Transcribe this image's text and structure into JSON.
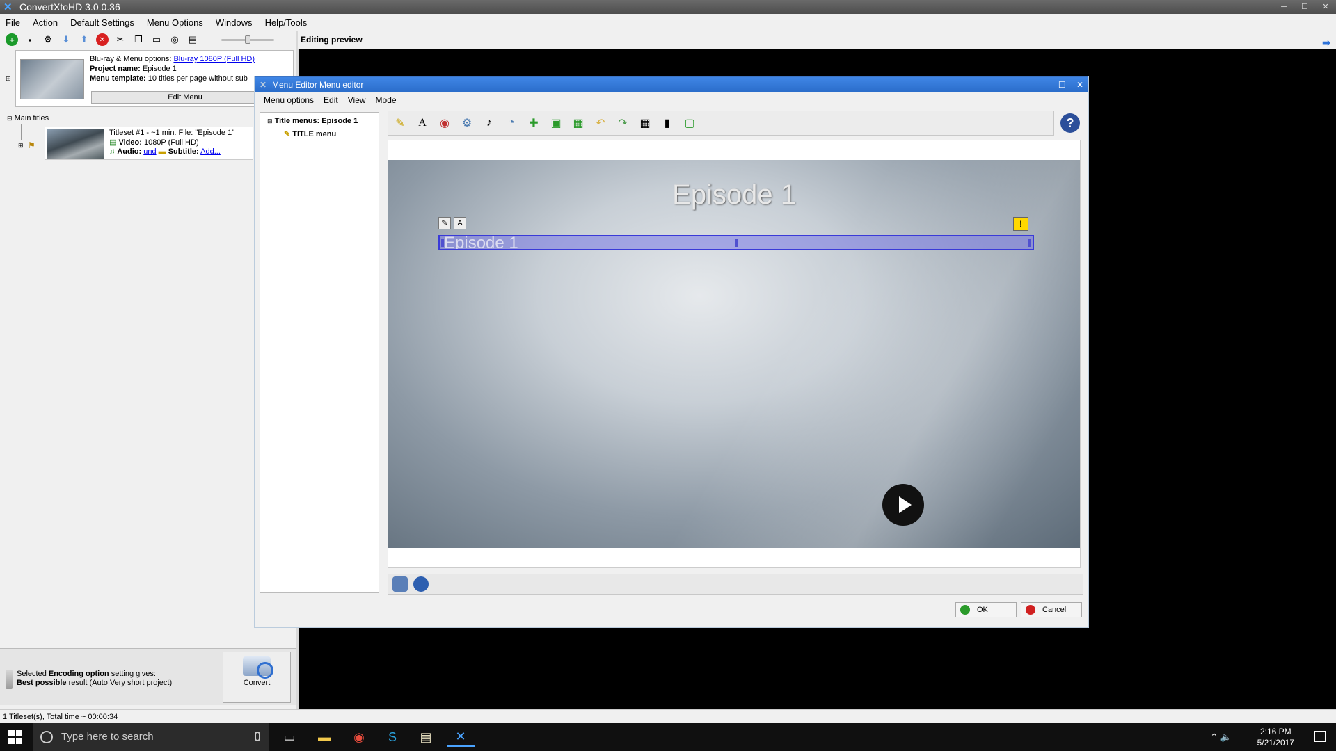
{
  "window": {
    "title": "ConvertXtoHD 3.0.0.36"
  },
  "menubar": [
    "File",
    "Action",
    "Default Settings",
    "Menu Options",
    "Windows",
    "Help/Tools"
  ],
  "project": {
    "options_label": "Blu-ray & Menu options:",
    "options_value": "Blu-ray 1080P (Full HD)",
    "name_label": "Project name:",
    "name_value": "Episode 1",
    "template_label": "Menu template:",
    "template_value": "10 titles per page without sub",
    "edit_menu": "Edit Menu"
  },
  "main_titles": "Main titles",
  "titleset": {
    "line1": "Titleset #1 - ~1 min. File: \"Episode 1\"",
    "video_label": "Video:",
    "video_value": "1080P (Full HD)",
    "audio_label": "Audio:",
    "audio_value": "und",
    "subtitle_label": "Subtitle:",
    "subtitle_value": "Add..."
  },
  "encoding": {
    "line1_a": "Selected ",
    "line1_b": "Encoding option",
    "line1_c": " setting gives:",
    "line2_a": "Best possible",
    "line2_b": " result (Auto Very short project)"
  },
  "convert_label": "Convert",
  "status_text": "1 Titleset(s), Total time ~ 00:00:34",
  "preview_header": "Editing preview",
  "dialog": {
    "title": "Menu Editor Menu editor",
    "menu": [
      "Menu options",
      "Edit",
      "View",
      "Mode"
    ],
    "tree_root": "Title menus: Episode 1",
    "tree_child": "TITLE menu",
    "menu_title": "Episode 1",
    "selected_text": "Episode 1",
    "ok": "OK",
    "cancel": "Cancel"
  },
  "taskbar": {
    "search_placeholder": "Type here to search",
    "time": "2:16 PM",
    "date": "5/21/2017"
  },
  "colors": {
    "accent": "#2a6cc9",
    "selection": "#3a3ad8",
    "warning": "#ffd800"
  }
}
